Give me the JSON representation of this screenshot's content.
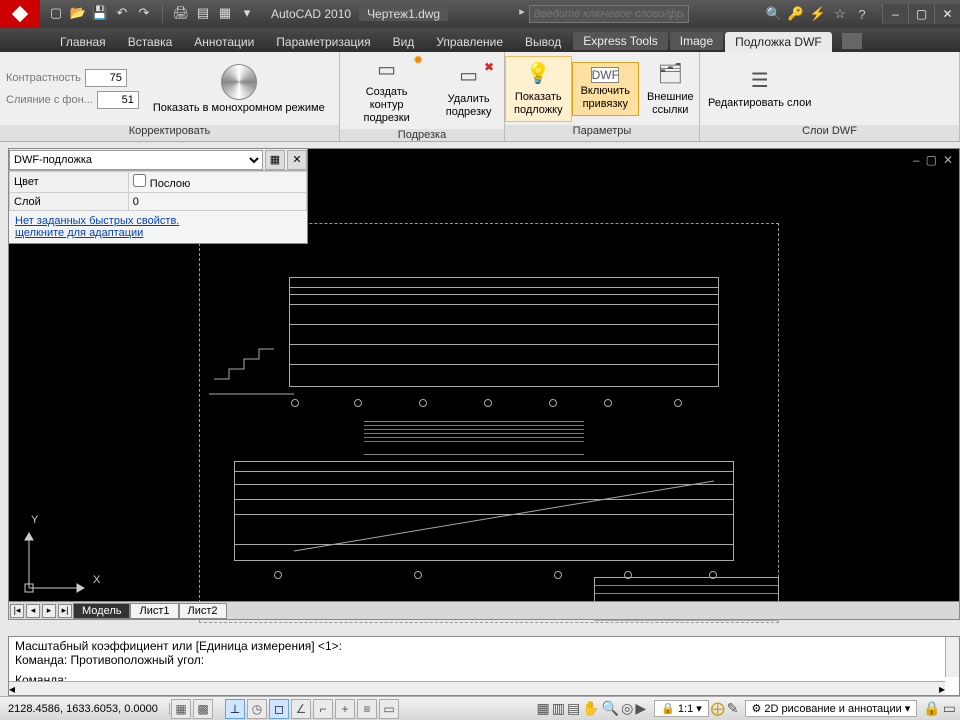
{
  "title": {
    "app": "AutoCAD 2010",
    "doc": "Чертеж1.dwg",
    "search_placeholder": "Введите ключевое слово/фразу"
  },
  "qat": [
    "new",
    "open",
    "save",
    "undo",
    "redo",
    "print",
    "plot-preview",
    "publish",
    "arrow"
  ],
  "win": {
    "min": "–",
    "max": "▢",
    "close": "✕"
  },
  "tabs": [
    "Главная",
    "Вставка",
    "Аннотации",
    "Параметризация",
    "Вид",
    "Управление",
    "Вывод",
    "Express Tools",
    "Image",
    "Подложка DWF"
  ],
  "active_tab": 9,
  "ribbon": {
    "adjust": {
      "contrast_label": "Контрастность",
      "contrast_val": "75",
      "fade_label": "Слияние с фон...",
      "fade_val": "51",
      "mono": "Показать в монохромном режиме",
      "panel": "Корректировать"
    },
    "clip": {
      "create": "Создать контур подрезки",
      "delete": "Удалить подрезку",
      "panel": "Подрезка"
    },
    "options": {
      "show": "Показать подложку",
      "snap": "Включить привязку",
      "xref": "Внешние ссылки",
      "panel": "Параметры"
    },
    "layers": {
      "edit": "Редактировать слои",
      "panel": "Слои DWF"
    }
  },
  "props": {
    "sel": "DWF-подложка",
    "rows": [
      {
        "k": "Цвет",
        "v": "Послою",
        "cb": true
      },
      {
        "k": "Слой",
        "v": "0"
      }
    ],
    "link1": "Нет заданных быстрых свойств.",
    "link2": "щелкните для адаптации"
  },
  "layout_tabs": [
    "Модель",
    "Лист1",
    "Лист2"
  ],
  "cmd": {
    "l1": "Масштабный коэффициент или [Единица измерения] <1>:",
    "l2": "Команда: Противоположный угол:",
    "l3": "Команда:"
  },
  "status": {
    "coords": "2128.4586, 1633.6053, 0.0000",
    "scale": "1:1",
    "mode": "2D рисование и аннотации"
  }
}
